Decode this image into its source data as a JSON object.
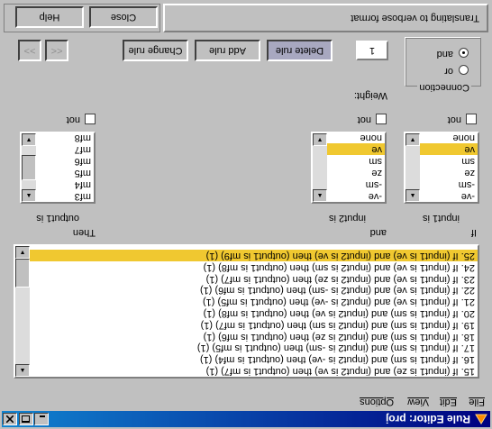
{
  "window": {
    "title": "Rule Editor: proj",
    "icon": "app-icon"
  },
  "menu": [
    "File",
    "Edit",
    "View",
    "Options"
  ],
  "rules": [
    "15. If (input1 is ze) and (input2 is ve) then (output1 is mf7) (1)",
    "16. If (input1 is sm) and (input2 is -ve) then (output1 is mf4) (1)",
    "17. If (input1 is sm) and (input2 is -sm) then (output1 is mf5) (1)",
    "18. If (input1 is sm) and (input2 is ze) then (output1 is mf6) (1)",
    "19. If (input1 is sm) and (input2 is sm) then (output1 is mf7) (1)",
    "20. If (input1 is sm) and (input2 is ve) then (output1 is mf8) (1)",
    "21. If (input1 is ve) and (input2 is -ve) then (output1 is mf5) (1)",
    "22. If (input1 is ve) and (input2 is -sm) then (output1 is mf6) (1)",
    "23. If (input1 is ve) and (input2 is ze) then (output1 is mf7) (1)",
    "24. If (input1 is ve) and (input2 is sm) then (output1 is mf8) (1)",
    "25. If (input1 is ve) and (input2 is ve) then (output1 is mf9) (1)"
  ],
  "selected_rule": 10,
  "if_label": "If",
  "and_label": "and",
  "then_label": "Then",
  "input1": {
    "label": "input1 is",
    "items": [
      "-ve",
      "-sm",
      "ze",
      "sm",
      "ve",
      "none"
    ],
    "selected": 4,
    "not_label": "not"
  },
  "input2": {
    "label": "input2 is",
    "items": [
      "-ve",
      "-sm",
      "ze",
      "sm",
      "ve",
      "none"
    ],
    "selected": 4,
    "not_label": "not"
  },
  "output1": {
    "label": "output1 is",
    "items": [
      "mf3",
      "mf4",
      "mf5",
      "mf6",
      "mf7",
      "mf8"
    ],
    "not_label": "not"
  },
  "connection": {
    "label": "Connection",
    "or_label": "or",
    "and_label": "and",
    "selected": "and"
  },
  "weight": {
    "label": "Weight:",
    "value": "1"
  },
  "buttons": {
    "delete": "Delete rule",
    "add": "Add rule",
    "change": "Change rule",
    "prev": "<<",
    "next": ">>"
  },
  "status": "Translating to verbose format",
  "help_label": "Help",
  "close_label": "Close",
  "colors": {
    "title_start": "#000080",
    "title_end": "#1084d0",
    "selection": "#f0c830",
    "face": "#c0c0c0"
  }
}
